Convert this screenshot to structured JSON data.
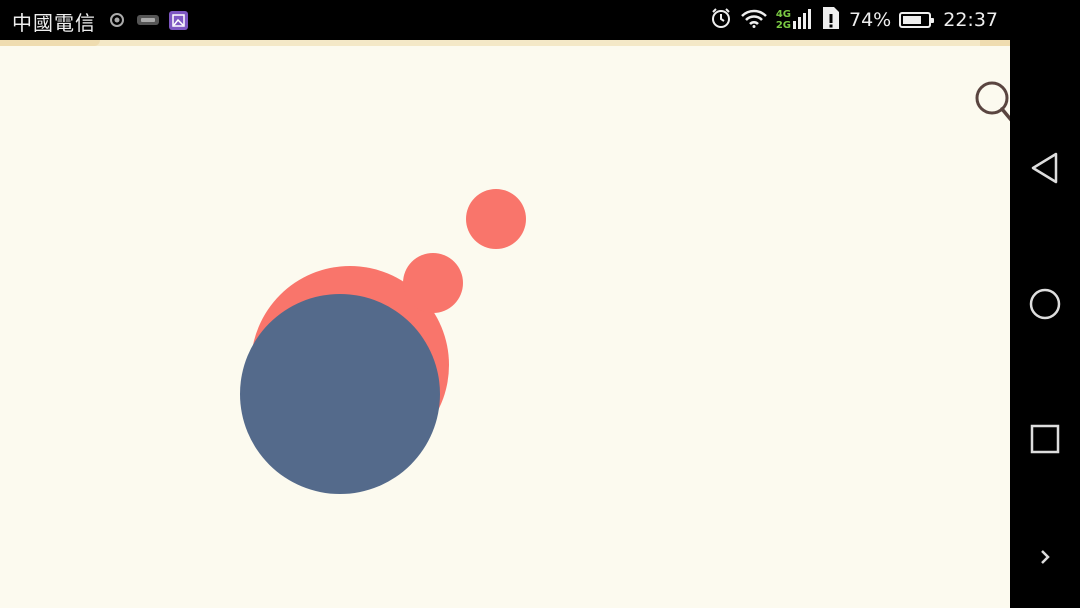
{
  "status_bar": {
    "carrier": "中國電信",
    "network_top": "4G",
    "network_bottom": "2G",
    "battery_percent": "74%",
    "battery_level": 0.74,
    "time": "22:37",
    "icons": [
      "notification-circle-icon",
      "tap-app-icon",
      "gallery-app-icon",
      "alarm-icon",
      "wifi-icon",
      "signal-icon",
      "sim-alert-icon",
      "battery-icon"
    ]
  },
  "game": {
    "colors": {
      "background": "#fcfaef",
      "blob": "#f9756b",
      "player": "#546a8b",
      "icon_stroke": "#5a4540"
    },
    "icons": [
      "search-icon"
    ]
  },
  "nav_bar": {
    "icons": [
      "back-triangle-icon",
      "home-circle-icon",
      "recents-square-icon",
      "expand-chevron-icon"
    ]
  }
}
